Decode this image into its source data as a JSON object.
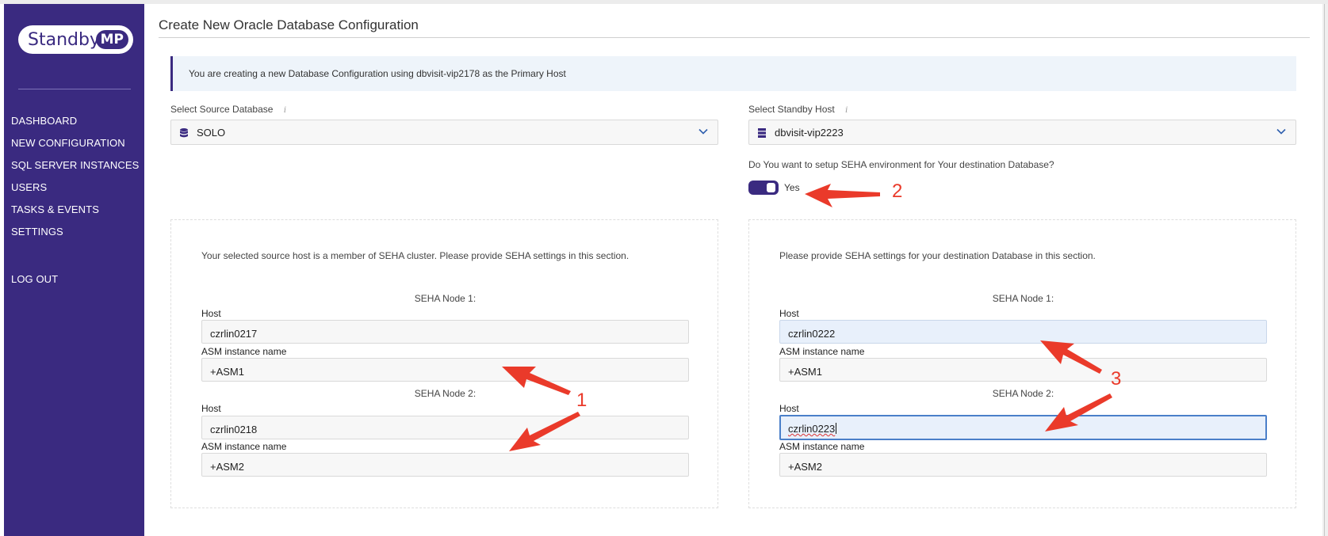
{
  "sidebar": {
    "logo_text": "Standby",
    "logo_badge": "MP",
    "nav": [
      "DASHBOARD",
      "NEW CONFIGURATION",
      "SQL SERVER INSTANCES",
      "USERS",
      "TASKS & EVENTS",
      "SETTINGS"
    ],
    "logout": "LOG OUT"
  },
  "page": {
    "title": "Create New Oracle Database Configuration",
    "info": "You are creating a new Database Configuration using dbvisit-vip2178 as the Primary Host"
  },
  "source": {
    "label": "Select Source Database",
    "value": "SOLO"
  },
  "standby": {
    "label": "Select Standby Host",
    "value": "dbvisit-vip2223",
    "seha_question": "Do You want to setup SEHA environment for Your destination Database?",
    "seha_enabled": true,
    "toggle_label": "Yes"
  },
  "left_panel": {
    "description": "Your selected source host is a member of SEHA cluster. Please provide SEHA settings in this section.",
    "node1": {
      "title": "SEHA Node 1:",
      "host_label": "Host",
      "host": "czrlin0217",
      "asm_label": "ASM instance name",
      "asm": "+ASM1"
    },
    "node2": {
      "title": "SEHA Node 2:",
      "host_label": "Host",
      "host": "czrlin0218",
      "asm_label": "ASM instance name",
      "asm": "+ASM2"
    }
  },
  "right_panel": {
    "description": "Please provide SEHA settings for your destination Database in this section.",
    "node1": {
      "title": "SEHA Node 1:",
      "host_label": "Host",
      "host": "czrlin0222",
      "asm_label": "ASM instance name",
      "asm": "+ASM1"
    },
    "node2": {
      "title": "SEHA Node 2:",
      "host_label": "Host",
      "host": "czrlin0223",
      "asm_label": "ASM instance name",
      "asm": "+ASM2"
    }
  },
  "annotations": {
    "one": "1",
    "two": "2",
    "three": "3"
  },
  "colors": {
    "sidebar": "#3a2a80",
    "annotation": "#ea3a2a",
    "focus": "#4a7fc9"
  },
  "icons": {
    "database": "database-icon",
    "server": "server-icon",
    "chevron": "chevron-down-icon",
    "info": "info-icon"
  }
}
